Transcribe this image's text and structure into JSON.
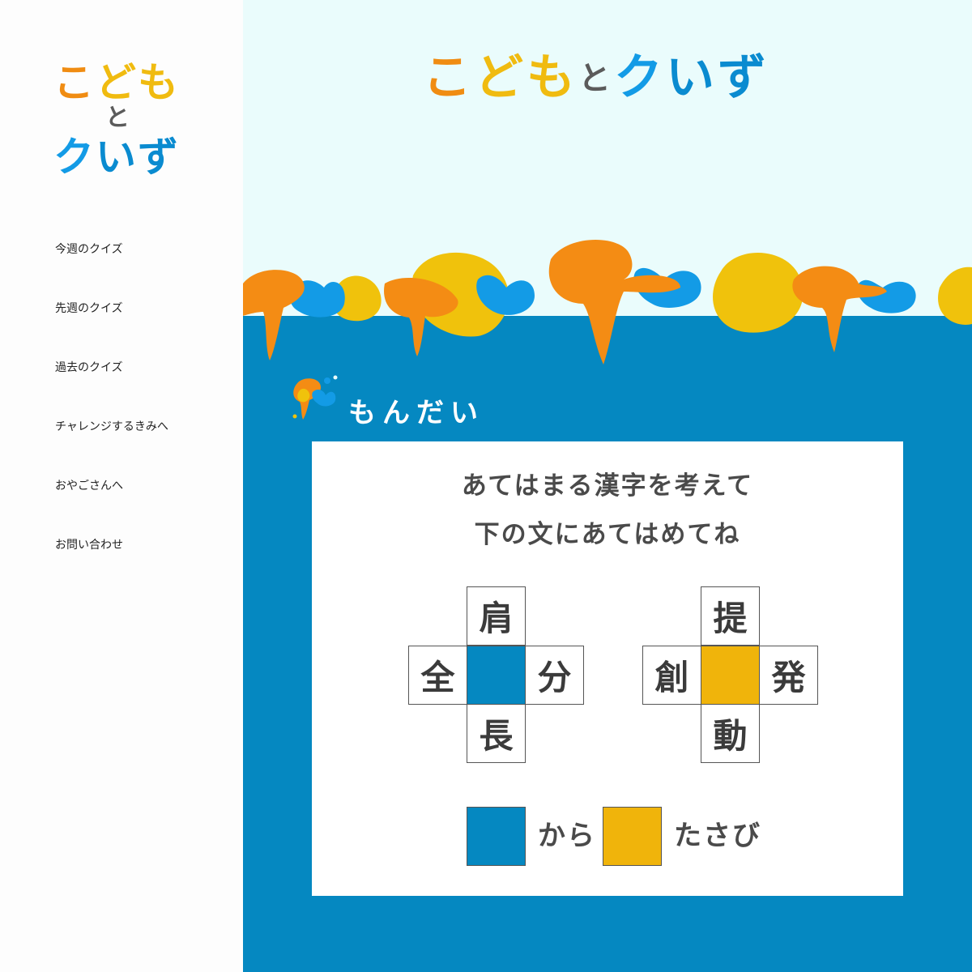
{
  "brand": {
    "logo_row1": [
      "こ",
      "ど",
      "も"
    ],
    "logo_to": "と",
    "logo_row2": [
      "ク",
      "い",
      "ず"
    ],
    "colors": {
      "orange": "#f08c12",
      "yellow": "#f0bb10",
      "blue": "#0588c1",
      "light_blue": "#139be6",
      "gold": "#f0b40b",
      "hero_bg": "#eafcfc"
    }
  },
  "nav": {
    "items": [
      {
        "label": "今週のクイズ"
      },
      {
        "label": "先週のクイズ"
      },
      {
        "label": "過去のクイズ"
      },
      {
        "label": "チャレンジするきみへ"
      },
      {
        "label": "おやごさんへ"
      },
      {
        "label": "お問い合わせ"
      }
    ]
  },
  "section": {
    "title": "もんだい",
    "icon": "paint-splash-icon"
  },
  "question": {
    "line1": "あてはまる漢字を考えて",
    "line2": "下の文にあてはめてね"
  },
  "puzzles": [
    {
      "top": "肩",
      "left": "全",
      "right": "分",
      "bottom": "長",
      "center_color": "blue"
    },
    {
      "top": "提",
      "left": "創",
      "right": "発",
      "bottom": "動",
      "center_color": "gold"
    }
  ],
  "legend": {
    "text1": "から",
    "text2": "たさび"
  }
}
